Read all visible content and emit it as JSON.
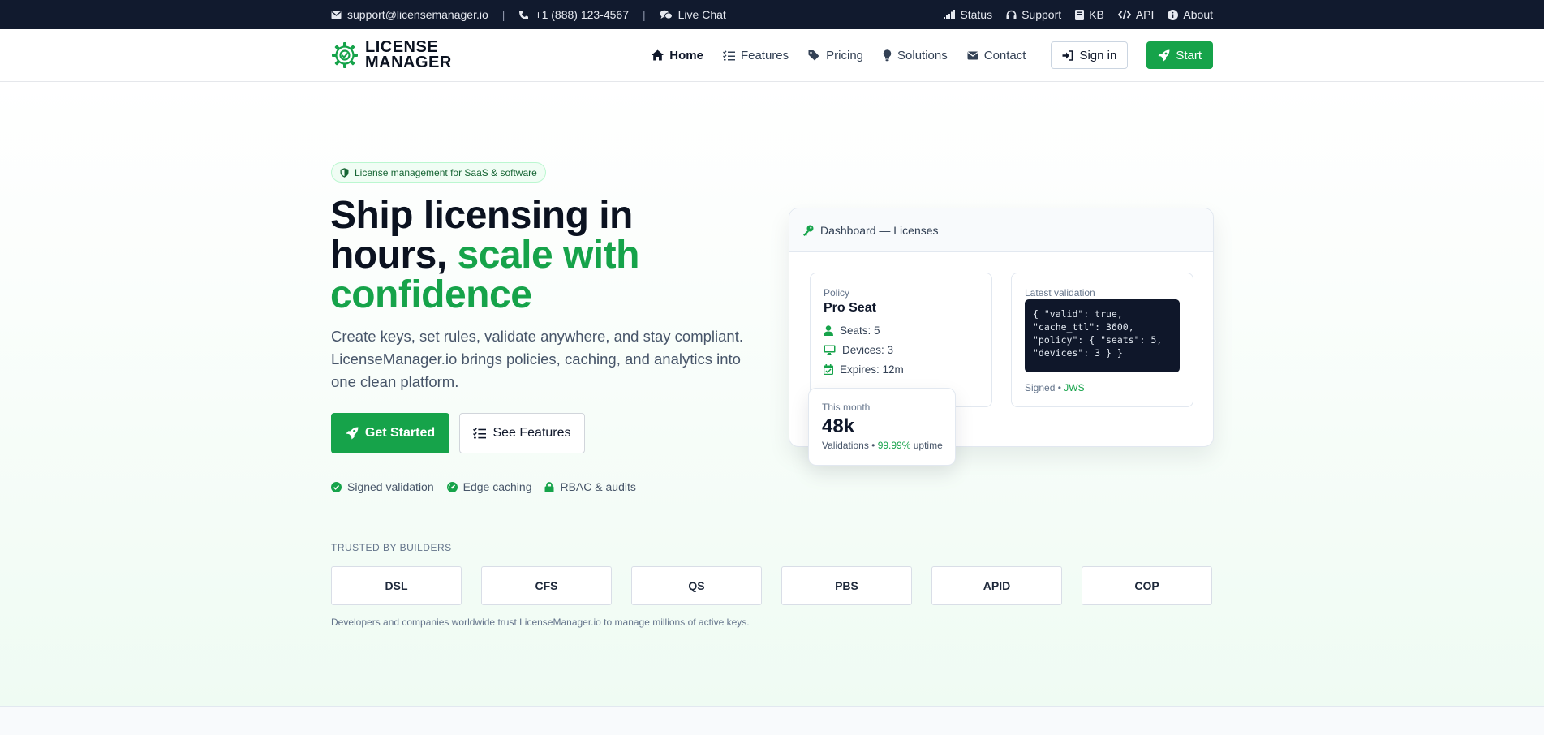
{
  "topbar": {
    "email": "support@licensemanager.io",
    "phone": "+1 (888) 123-4567",
    "chat": "Live Chat",
    "separator": "|",
    "links": [
      "Status",
      "Support",
      "KB",
      "API",
      "About"
    ]
  },
  "brand": {
    "line1": "LICENSE",
    "line2": "MANAGER",
    "color": "#16a34a"
  },
  "nav": {
    "links": [
      "Home",
      "Features",
      "Pricing",
      "Solutions",
      "Contact"
    ],
    "signin": "Sign in",
    "start": "Start"
  },
  "hero": {
    "badge": "License management for SaaS & software",
    "headline_part1": "Ship licensing in hours,",
    "headline_accent": "scale with confidence",
    "subtext": "Create keys, set rules, validate anywhere, and stay compliant. LicenseManager.io brings policies, caching, and analytics into one clean platform.",
    "primary_cta": "Get Started",
    "secondary_cta": "See Features",
    "features": [
      "Signed validation",
      "Edge caching",
      "RBAC & audits"
    ]
  },
  "dashboard": {
    "title": "Dashboard — Licenses",
    "policy": {
      "label": "Policy",
      "name": "Pro Seat",
      "seats": "Seats: 5",
      "devices": "Devices: 3",
      "expires": "Expires: 12m"
    },
    "validation": {
      "label": "Latest validation",
      "code": "{ \"valid\": true,\n\"cache_ttl\": 3600,\n\"policy\": { \"seats\": 5,\n\"devices\": 3 } }",
      "signed_prefix": "Signed •",
      "signed_method": "JWS"
    },
    "month": {
      "label": "This month",
      "value": "48k",
      "sub_prefix": "Validations •",
      "uptime": "99.99%",
      "sub_suffix": "uptime"
    }
  },
  "trusted": {
    "label": "TRUSTED BY BUILDERS",
    "logos": [
      "DSL",
      "CFS",
      "QS",
      "PBS",
      "APID",
      "COP"
    ],
    "note": "Developers and companies worldwide trust LicenseManager.io to manage millions of active keys."
  },
  "colors": {
    "accent": "#16a34a",
    "topbar": "#111a2e",
    "ink": "#0f172a"
  }
}
